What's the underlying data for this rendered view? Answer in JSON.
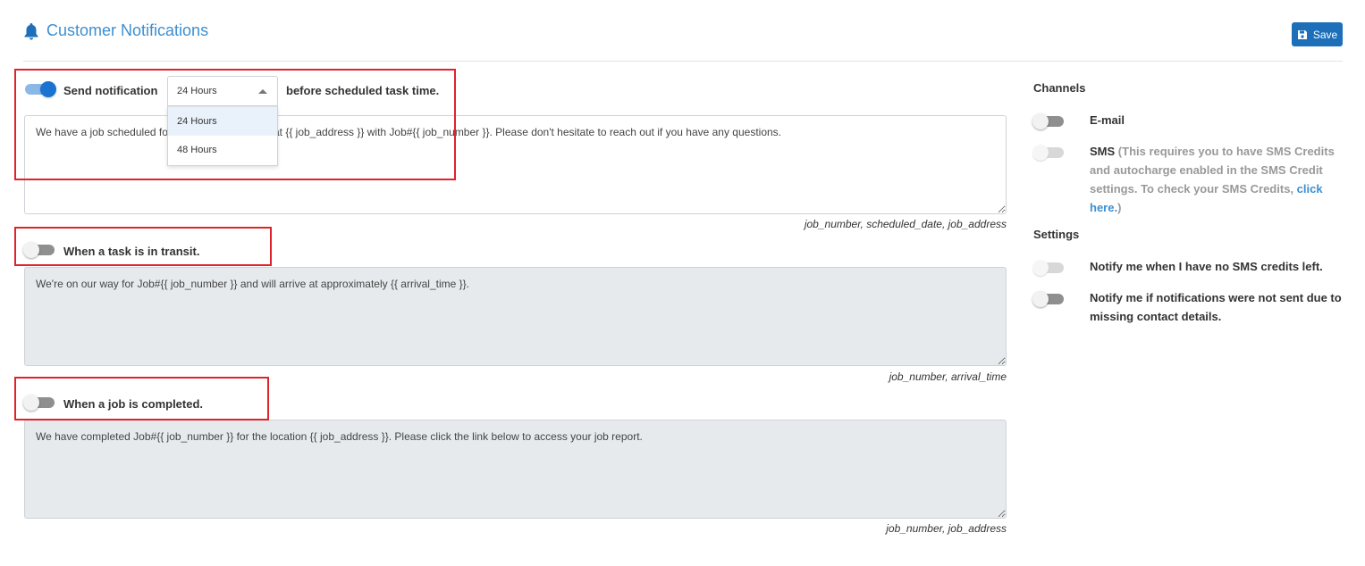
{
  "header": {
    "title": "Customer Notifications",
    "save_label": "Save"
  },
  "scheduled": {
    "toggle_on": true,
    "label_prefix": "Send notification",
    "selected": "24 Hours",
    "options": [
      "24 Hours",
      "48 Hours"
    ],
    "label_suffix": "before scheduled task time.",
    "message": "We have a job scheduled for {{ scheduled_date }} at {{ job_address }} with Job#{{ job_number }}. Please don't hesitate to reach out if you have any questions.",
    "variables": "job_number, scheduled_date, job_address"
  },
  "transit": {
    "toggle_on": false,
    "label": "When a task is in transit.",
    "message": "We're on our way for Job#{{ job_number }} and will arrive at approximately {{ arrival_time }}.",
    "variables": "job_number, arrival_time"
  },
  "completed": {
    "toggle_on": false,
    "label": "When a job is completed.",
    "message": "We have completed Job#{{ job_number }} for the location {{ job_address }}. Please click the link below to access your job report.",
    "variables": "job_number, job_address"
  },
  "channels": {
    "title": "Channels",
    "email_label": "E-mail",
    "sms_label": "SMS",
    "sms_note": "(This requires you to have SMS Credits and autocharge enabled in the SMS Credit settings. To check your SMS Credits,",
    "sms_link": "click here.",
    "sms_note_end": ")"
  },
  "settings": {
    "title": "Settings",
    "no_credits_label": "Notify me when I have no SMS credits left.",
    "not_sent_label": "Notify me if notifications were not sent due to missing contact details."
  },
  "colors": {
    "accent": "#1c6fb8",
    "title_blue": "#3d8fd1",
    "highlight_red": "#e0232a"
  }
}
